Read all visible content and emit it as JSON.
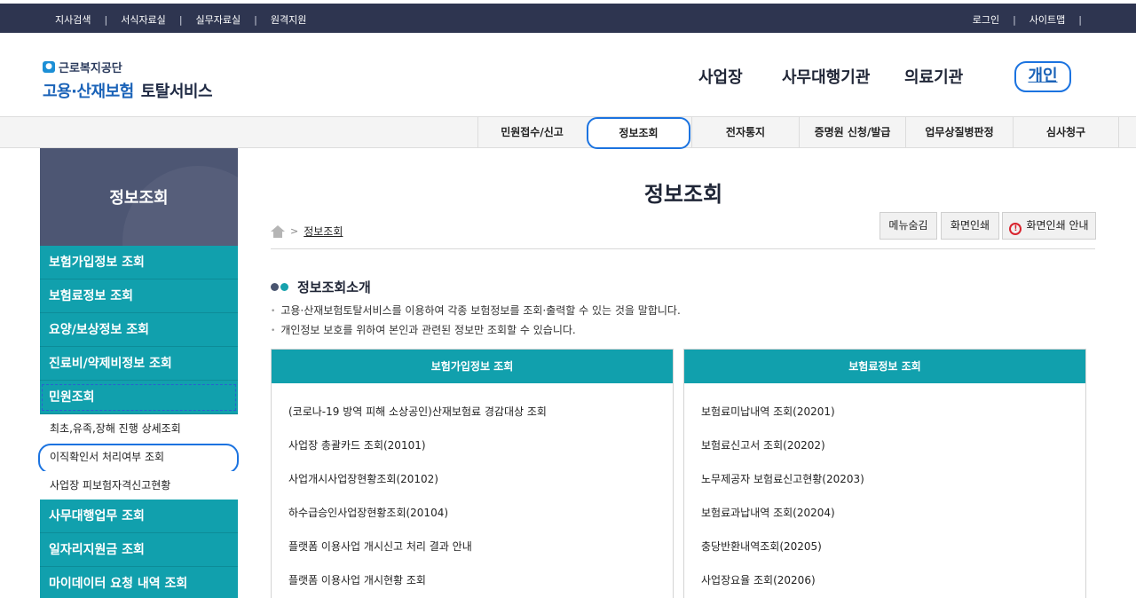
{
  "topbar": {
    "left_links": [
      "지사검색",
      "서식자료실",
      "실무자료실",
      "원격지원"
    ],
    "right_links": [
      "로그인",
      "사이트맵"
    ],
    "separator": "|"
  },
  "logo": {
    "org_name": "근로복지공단",
    "service_name_blue": "고용·산재보험",
    "service_name_dark": "토탈서비스"
  },
  "main_nav": {
    "items": [
      "사업장",
      "사무대행기관",
      "의료기관"
    ],
    "active_item": "개인"
  },
  "sub_nav": {
    "items": [
      "민원접수/신고",
      "정보조회",
      "전자통지",
      "증명원 신청/발급",
      "업무상질병판정",
      "심사청구"
    ],
    "active": "정보조회"
  },
  "sidebar": {
    "title": "정보조회",
    "items": [
      "보험가입정보 조회",
      "보험료정보 조회",
      "요양/보상정보 조회",
      "진료비/약제비정보 조회",
      "민원조회"
    ],
    "sub_items": [
      "최초,유족,장해 진행 상세조회",
      "이직확인서 처리여부 조회",
      "사업장 피보험자격신고현황"
    ],
    "items_after": [
      "사무대행업무 조회",
      "일자리지원금 조회",
      "마이데이터 요청 내역 조회"
    ]
  },
  "content": {
    "page_title": "정보조회",
    "breadcrumb_arrow": ">",
    "breadcrumb_current": "정보조회",
    "buttons": {
      "hide_menu": "메뉴숨김",
      "print": "화면인쇄",
      "print_guide": "화면인쇄 안내",
      "print_guide_icon_glyph": "!"
    },
    "section_title": "정보조회소개",
    "bullets": [
      "고용·산재보험토탈서비스를 이용하여 각종 보험정보를 조회·출력할 수 있는 것을 말합니다.",
      "개인정보 보호를 위하여 본인과 관련된 정보만 조회할 수 있습니다."
    ],
    "box_left": {
      "header": "보험가입정보 조회",
      "items": [
        "(코로나-19 방역 피해 소상공인)산재보험료 경감대상 조회",
        "사업장 총괄카드 조회(20101)",
        "사업개시사업장현황조회(20102)",
        "하수급승인사업장현황조회(20104)",
        "플랫폼 이용사업 개시신고 처리 결과 안내",
        "플랫폼 이용사업 개시현황 조회"
      ]
    },
    "box_right": {
      "header": "보험료정보 조회",
      "items": [
        "보험료미납내역 조회(20201)",
        "보험료신고서 조회(20202)",
        "노무제공자 보험료신고현황(20203)",
        "보험료과납내역 조회(20204)",
        "충당반환내역조회(20205)",
        "사업장요율 조회(20206)"
      ]
    }
  },
  "colors": {
    "topbar_bg": "#2e3550",
    "teal": "#11a0ad",
    "sidebar_head": "#4d5673",
    "highlight_circle": "#1b73e0",
    "brand_blue": "#1b63b8",
    "dot_dark": "#4a5570",
    "dot_teal": "#17a2ad"
  },
  "icons": [
    "home-icon",
    "warning-icon",
    "logo-mark-icon",
    "bullet-dot-icon"
  ]
}
